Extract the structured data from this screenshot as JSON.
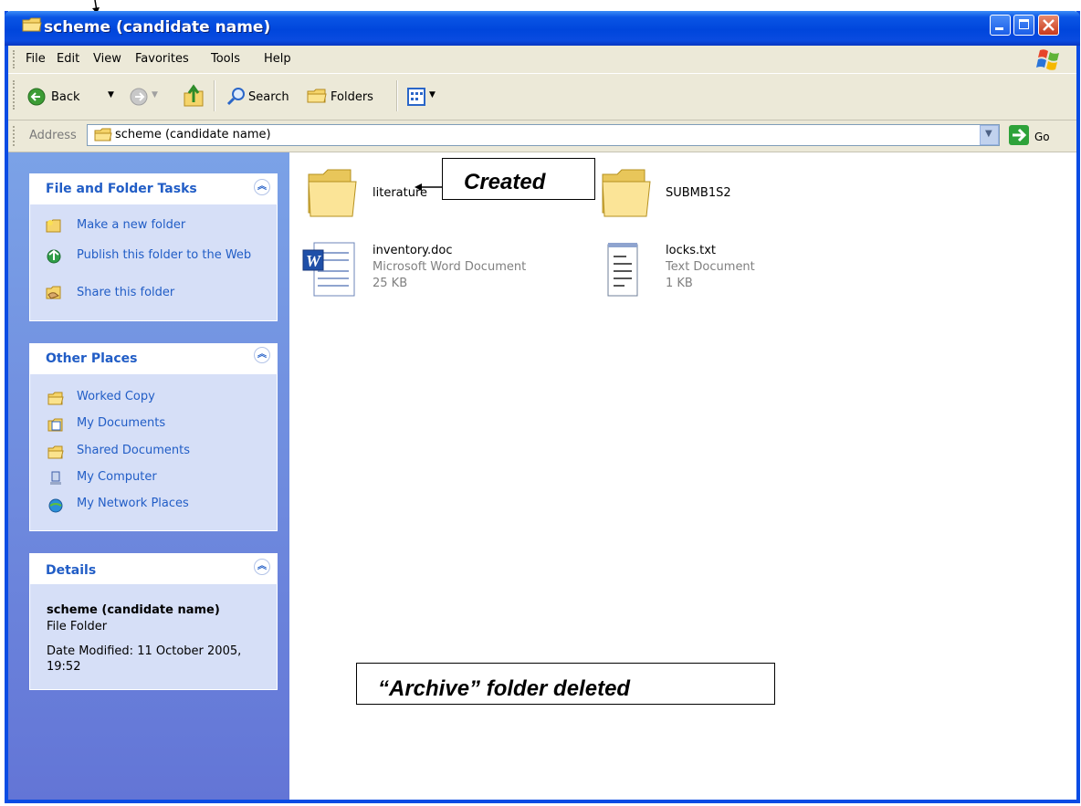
{
  "window": {
    "title": "scheme (candidate name)"
  },
  "menu": [
    "File",
    "Edit",
    "View",
    "Favorites",
    "Tools",
    "Help"
  ],
  "toolbar": {
    "back_label": "Back",
    "search_label": "Search",
    "folders_label": "Folders"
  },
  "address": {
    "label": "Address",
    "value": "scheme (candidate name)",
    "go_label": "Go"
  },
  "panels": {
    "file_tasks": {
      "title": "File and Folder Tasks",
      "items": [
        {
          "label": "Make a new folder",
          "icon": "new-folder-icon"
        },
        {
          "label": "Publish this folder to the Web",
          "icon": "publish-web-icon"
        },
        {
          "label": "Share this folder",
          "icon": "share-folder-icon"
        }
      ]
    },
    "other_places": {
      "title": "Other Places",
      "items": [
        {
          "label": "Worked Copy",
          "icon": "folder-icon"
        },
        {
          "label": "My Documents",
          "icon": "my-documents-icon"
        },
        {
          "label": "Shared Documents",
          "icon": "folder-icon"
        },
        {
          "label": "My Computer",
          "icon": "my-computer-icon"
        },
        {
          "label": "My Network Places",
          "icon": "network-places-icon"
        }
      ]
    },
    "details": {
      "title": "Details",
      "name": "scheme (candidate name)",
      "type": "File Folder",
      "modified": "Date Modified: 11 October 2005, 19:52"
    }
  },
  "files": [
    {
      "name": "literature",
      "type": "",
      "size": ""
    },
    {
      "name": "SUBMB1S2",
      "type": "",
      "size": ""
    },
    {
      "name": "inventory.doc",
      "type": "Microsoft Word Document",
      "size": "25 KB"
    },
    {
      "name": "locks.txt",
      "type": "Text Document",
      "size": "1 KB"
    }
  ],
  "annotations": {
    "created": "Created",
    "archive": "“Archive” folder deleted"
  },
  "colors": {
    "titlebar": "#0a4ce4",
    "panel_bg": "#d6dff7",
    "panel_heading": "#215dc6",
    "sidebar": "#6f8fe0"
  }
}
